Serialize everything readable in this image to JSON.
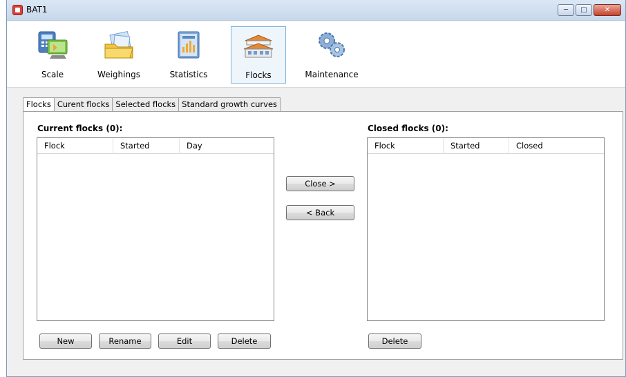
{
  "window": {
    "title": "BAT1"
  },
  "toolbar": [
    {
      "label": "Scale"
    },
    {
      "label": "Weighings"
    },
    {
      "label": "Statistics"
    },
    {
      "label": "Flocks"
    },
    {
      "label": "Maintenance"
    }
  ],
  "tabs": [
    "Flocks",
    "Curent flocks",
    "Selected flocks",
    "Standard growth curves"
  ],
  "current": {
    "title": "Current flocks (0):",
    "columns": [
      "Flock",
      "Started",
      "Day"
    ],
    "rows": [],
    "buttons": {
      "new": "New",
      "rename": "Rename",
      "edit": "Edit",
      "delete": "Delete"
    }
  },
  "middle": {
    "close": "Close  >",
    "back": "<  Back"
  },
  "closed": {
    "title": "Closed flocks (0):",
    "columns": [
      "Flock",
      "Started",
      "Closed"
    ],
    "rows": [],
    "buttons": {
      "delete": "Delete"
    }
  },
  "colors": {
    "accent": "#7db3df",
    "title_bar": "#c7d8ec",
    "close_button": "#c7432e"
  },
  "icons": [
    "scale-icon",
    "weighings-icon",
    "statistics-icon",
    "flocks-icon",
    "maintenance-icon"
  ]
}
